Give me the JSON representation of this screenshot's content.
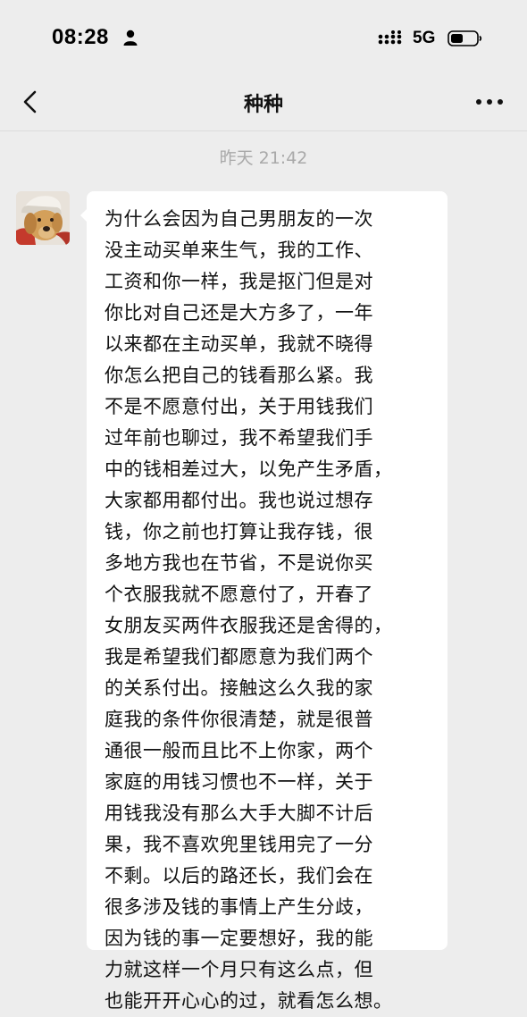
{
  "status_bar": {
    "time": "08:28",
    "network": "5G",
    "icons": [
      "person-icon",
      "signal-icon",
      "battery-icon"
    ]
  },
  "header": {
    "title": "种种",
    "back_icon": "chevron-left-icon",
    "more_icon": "more-dots-icon"
  },
  "chat": {
    "timestamp": "昨天 21:42",
    "message": {
      "lines": [
        "为什么会因为自己男朋友的一次",
        "没主动买单来生气，我的工作、",
        "工资和你一样，我是抠门但是对",
        "你比对自己还是大方多了，一年",
        "以来都在主动买单，我就不晓得",
        "你怎么把自己的钱看那么紧。我",
        "不是不愿意付出，关于用钱我们",
        "过年前也聊过，我不希望我们手",
        "中的钱相差过大，以免产生矛盾，",
        "大家都用都付出。我也说过想存",
        "钱，你之前也打算让我存钱，很",
        "多地方我也在节省，不是说你买",
        "个衣服我就不愿意付了，开春了",
        "女朋友买两件衣服我还是舍得的，",
        "我是希望我们都愿意为我们两个",
        "的关系付出。接触这么久我的家",
        "庭我的条件你很清楚，就是很普",
        "通很一般而且比不上你家，两个",
        "家庭的用钱习惯也不一样，关于",
        "用钱我没有那么大手大脚不计后",
        "果，我不喜欢兜里钱用完了一分",
        "不剩。以后的路还长，我们会在",
        "很多涉及钱的事情上产生分歧，",
        "因为钱的事一定要想好，我的能",
        "力就这样一个月只有这么点，但",
        "也能开开心心的过，就看怎么想。"
      ]
    }
  },
  "colors": {
    "background": "#ededed",
    "bubble": "#ffffff",
    "timestamp": "#a9a9a9"
  }
}
